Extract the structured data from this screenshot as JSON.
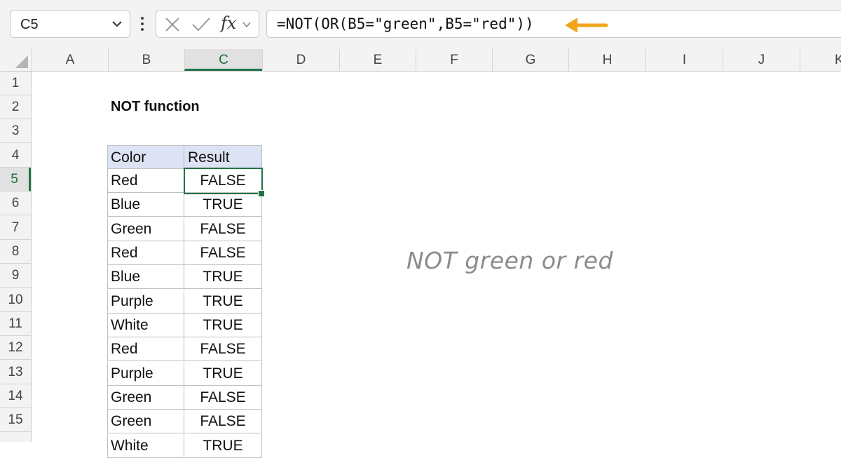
{
  "formula_bar": {
    "name_box": "C5",
    "fx_label": "fx",
    "formula": "=NOT(OR(B5=\"green\",B5=\"red\"))",
    "arrow_color": "#f0a51c"
  },
  "columns": [
    "A",
    "B",
    "C",
    "D",
    "E",
    "F",
    "G",
    "H",
    "I",
    "J",
    "K"
  ],
  "selected_column": "C",
  "rows": [
    "1",
    "2",
    "3",
    "4",
    "5",
    "6",
    "7",
    "8",
    "9",
    "10",
    "11",
    "12",
    "13",
    "14",
    "15"
  ],
  "selected_row": "5",
  "sheet": {
    "title": "NOT function",
    "table": {
      "headers": [
        "Color",
        "Result"
      ],
      "rows": [
        [
          "Red",
          "FALSE"
        ],
        [
          "Blue",
          "TRUE"
        ],
        [
          "Green",
          "FALSE"
        ],
        [
          "Red",
          "FALSE"
        ],
        [
          "Blue",
          "TRUE"
        ],
        [
          "Purple",
          "TRUE"
        ],
        [
          "White",
          "TRUE"
        ],
        [
          "Red",
          "FALSE"
        ],
        [
          "Purple",
          "TRUE"
        ],
        [
          "Green",
          "FALSE"
        ],
        [
          "Green",
          "FALSE"
        ],
        [
          "White",
          "TRUE"
        ]
      ]
    },
    "note": "NOT green or red"
  },
  "colors": {
    "accent": "#217346",
    "header_fill": "#dde3f4"
  }
}
